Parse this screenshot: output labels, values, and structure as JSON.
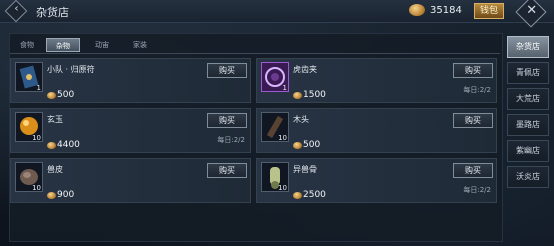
{
  "header": {
    "title": "杂货店",
    "currency_value": "35184",
    "currency_button": "钱包"
  },
  "tabs": [
    {
      "label": "食物"
    },
    {
      "label": "杂物",
      "active": true
    },
    {
      "label": "动宙"
    },
    {
      "label": "家装"
    }
  ],
  "items": [
    {
      "name": "小队 · 归原符",
      "price": "500",
      "qty": "1",
      "buy": "购买",
      "limit": "",
      "icon": "talisman-icon"
    },
    {
      "name": "虎齿夹",
      "price": "1500",
      "qty": "1",
      "buy": "购买",
      "limit": "每日:2/2",
      "icon": "tiger-tooth-clip-icon",
      "epic": true
    },
    {
      "name": "玄玉",
      "price": "4400",
      "qty": "10",
      "buy": "购买",
      "limit": "每日:2/2",
      "icon": "jade-orb-icon"
    },
    {
      "name": "木头",
      "price": "500",
      "qty": "10",
      "buy": "购买",
      "limit": "",
      "icon": "wood-log-icon"
    },
    {
      "name": "兽皮",
      "price": "900",
      "qty": "10",
      "buy": "购买",
      "limit": "",
      "icon": "beast-hide-icon"
    },
    {
      "name": "异兽骨",
      "price": "2500",
      "qty": "10",
      "buy": "购买",
      "limit": "每日:2/2",
      "icon": "beast-bone-icon"
    }
  ],
  "side_nav": [
    {
      "label": "杂货店",
      "active": true
    },
    {
      "label": "青佩店"
    },
    {
      "label": "大荒店"
    },
    {
      "label": "墨路店"
    },
    {
      "label": "紫幽店"
    },
    {
      "label": "沃炎店"
    }
  ]
}
